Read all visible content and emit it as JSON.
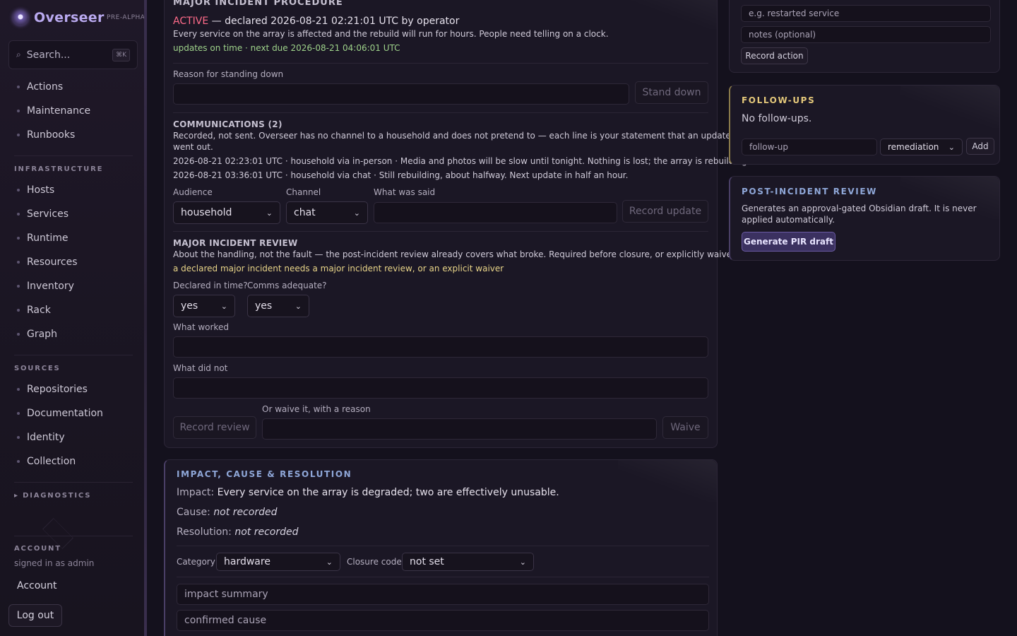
{
  "sidebar": {
    "brand": "Overseer",
    "tag": "PRE-ALPHA",
    "search_placeholder": "Search...",
    "search_kbd": "⌘K",
    "top_items": [
      "Actions",
      "Maintenance",
      "Runbooks"
    ],
    "infrastructure_label": "INFRASTRUCTURE",
    "infrastructure_items": [
      "Hosts",
      "Services",
      "Runtime",
      "Resources",
      "Inventory",
      "Rack",
      "Graph"
    ],
    "sources_label": "SOURCES",
    "sources_items": [
      "Repositories",
      "Documentation",
      "Identity",
      "Collection"
    ],
    "diagnostics_label": "▸ DIAGNOSTICS",
    "account_label": "ACCOUNT",
    "signed_in": "signed in as admin",
    "account_link": "Account",
    "logout": "Log out"
  },
  "procedure": {
    "title": "MAJOR INCIDENT PROCEDURE",
    "status": "ACTIVE",
    "status_rest": " — declared 2026-08-21 02:21:01 UTC by operator",
    "description": "Every service on the array is affected and the rebuild will run for hours. People need telling on a clock.",
    "updates": "updates on time · next due 2026-08-21 04:06:01 UTC",
    "stand_down_label": "Reason for standing down",
    "stand_down_button": "Stand down",
    "comms_title": "COMMUNICATIONS (2)",
    "comms_desc_1": "Recorded, not sent. Overseer has no channel to a household and does not pretend to — each line is your statement that an update",
    "comms_desc_2": "went out.",
    "comms_lines": [
      "2026-08-21 02:23:01 UTC · household via in-person · Media and photos will be slow until tonight. Nothing is lost; the array is rebuilding.",
      "2026-08-21 03:36:01 UTC · household via chat · Still rebuilding, about halfway. Next update in half an hour."
    ],
    "audience_label": "Audience",
    "audience_value": "household",
    "channel_label": "Channel",
    "channel_value": "chat",
    "said_label": "What was said",
    "record_update": "Record update",
    "review_title": "MAJOR INCIDENT REVIEW",
    "review_desc": "About the handling, not the fault — the post-incident review already covers what broke. Required before closure, or explicitly waived.",
    "review_warning": "a declared major incident needs a major incident review, or an explicit waiver",
    "declared_label": "Declared in time?",
    "declared_value": "yes",
    "comms_adequate_label": "Comms adequate?",
    "comms_adequate_value": "yes",
    "worked_label": "What worked",
    "did_not_label": "What did not",
    "record_review": "Record review",
    "waive_label": "Or waive it, with a reason",
    "waive_button": "Waive"
  },
  "impact": {
    "title": "IMPACT, CAUSE & RESOLUTION",
    "impact_key": "Impact:",
    "impact_val": "Every service on the array is degraded; two are effectively unusable.",
    "cause_key": "Cause:",
    "cause_val": "not recorded",
    "resolution_key": "Resolution:",
    "resolution_val": "not recorded",
    "category_label": "Category",
    "category_value": "hardware",
    "closure_label": "Closure code",
    "closure_value": "not set",
    "impact_placeholder": "impact summary",
    "cause_placeholder": "confirmed cause"
  },
  "actions": {
    "action_placeholder": "e.g. restarted service",
    "notes_placeholder": "notes (optional)",
    "record_action": "Record action"
  },
  "followups": {
    "title": "FOLLOW-UPS",
    "empty": "No follow-ups.",
    "input_placeholder": "follow-up",
    "type_value": "remediation",
    "add": "Add"
  },
  "pir": {
    "title": "POST-INCIDENT REVIEW",
    "desc_1": "Generates an approval-gated Obsidian draft. It is never",
    "desc_2": "applied automatically.",
    "button": "Generate PIR draft"
  },
  "colors": {
    "active": "#ff6b8a",
    "ok": "#9ed28a",
    "warning": "#e8d488",
    "accent": "#8fa7d8"
  }
}
